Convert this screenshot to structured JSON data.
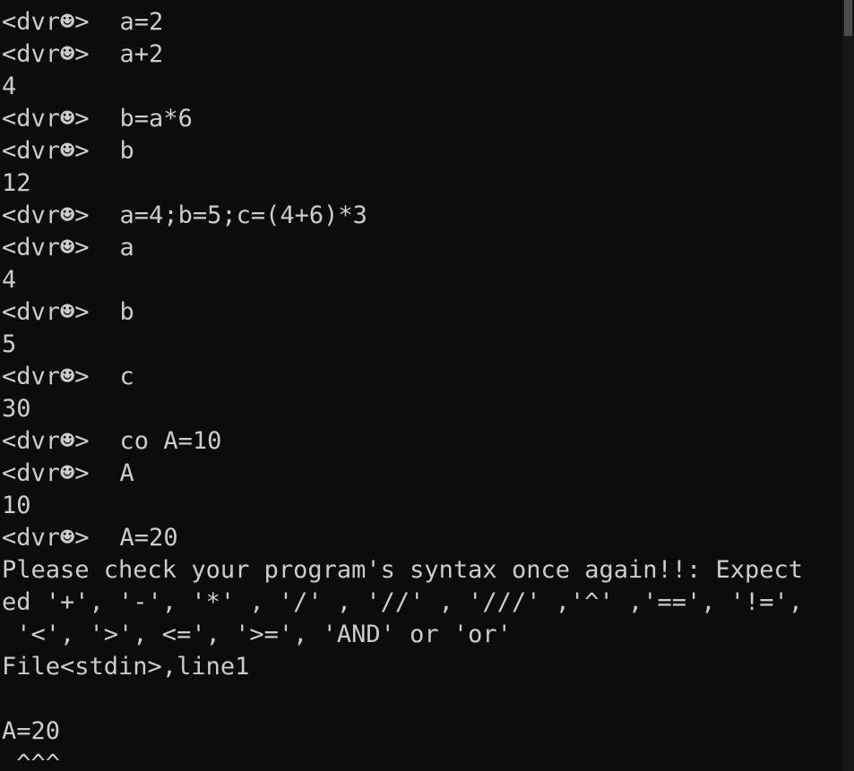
{
  "console": {
    "prompt": "<dvr☻>",
    "lines": [
      {
        "kind": "input",
        "text": "a=2"
      },
      {
        "kind": "input",
        "text": "a+2"
      },
      {
        "kind": "output",
        "text": "4"
      },
      {
        "kind": "input",
        "text": "b=a*6"
      },
      {
        "kind": "input",
        "text": "b"
      },
      {
        "kind": "output",
        "text": "12"
      },
      {
        "kind": "input",
        "text": "a=4;b=5;c=(4+6)*3"
      },
      {
        "kind": "input",
        "text": "a"
      },
      {
        "kind": "output",
        "text": "4"
      },
      {
        "kind": "input",
        "text": "b"
      },
      {
        "kind": "output",
        "text": "5"
      },
      {
        "kind": "input",
        "text": "c"
      },
      {
        "kind": "output",
        "text": "30"
      },
      {
        "kind": "input",
        "text": "co A=10"
      },
      {
        "kind": "input",
        "text": "A"
      },
      {
        "kind": "output",
        "text": "10"
      },
      {
        "kind": "input",
        "text": "A=20"
      },
      {
        "kind": "output",
        "text": "Please check your program's syntax once again!!: Expect"
      },
      {
        "kind": "output",
        "text": "ed '+', '-', '*' , '/' , '//' , '///' ,'^' ,'==', '!=',"
      },
      {
        "kind": "output",
        "text": " '<', '>', <=', '>=', 'AND' or 'or'"
      },
      {
        "kind": "output",
        "text": "File<stdin>,line1"
      },
      {
        "kind": "output",
        "text": ""
      },
      {
        "kind": "output",
        "text": "A=20"
      },
      {
        "kind": "output",
        "text": " ^^^"
      }
    ]
  }
}
